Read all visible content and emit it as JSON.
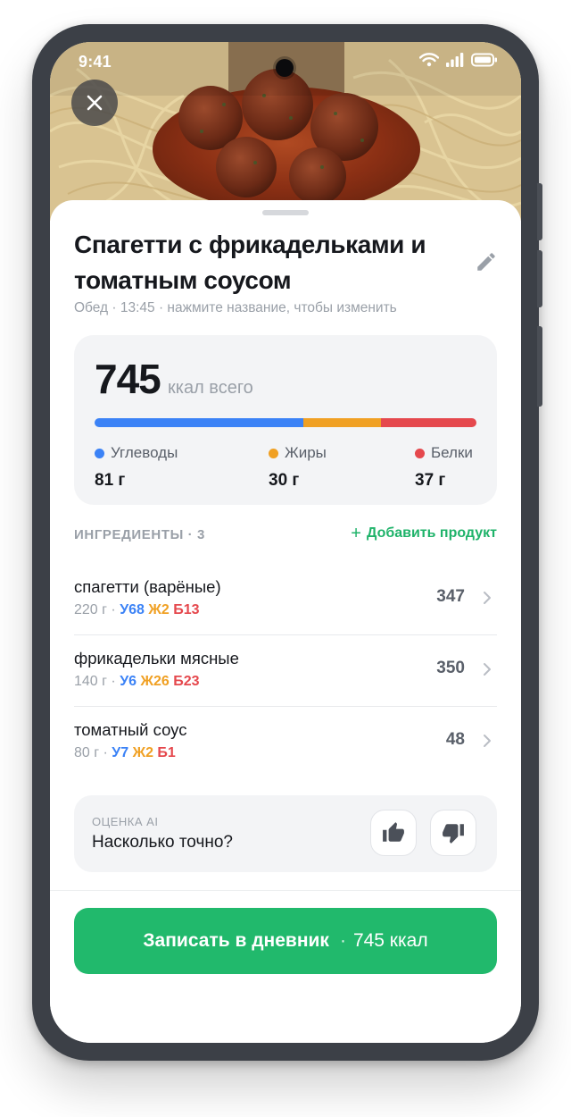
{
  "status_bar": {
    "time": "9:41"
  },
  "meal": {
    "title": "Спагетти с фрикадельками и томатным соусом",
    "subtitle": "Обед · 13:45 · нажмите название, чтобы изменить"
  },
  "summary": {
    "kcal_total": "745",
    "kcal_label": "ккал всего",
    "macros": [
      {
        "label": "Углеводы",
        "value": "81 г",
        "grams": 81,
        "color": "#3b82f6"
      },
      {
        "label": "Жиры",
        "value": "30 г",
        "grams": 30,
        "color": "#f0a023"
      },
      {
        "label": "Белки",
        "value": "37 г",
        "grams": 37,
        "color": "#e5484d"
      }
    ]
  },
  "ingredients": {
    "header": "ИНГРЕДИЕНТЫ · 3",
    "add_label": "Добавить продукт",
    "items": [
      {
        "name": "спагетти (варёные)",
        "weight": "220 г",
        "carbs": "У68",
        "fat": "Ж2",
        "protein": "Б13",
        "kcal": "347"
      },
      {
        "name": "фрикадельки мясные",
        "weight": "140 г",
        "carbs": "У6",
        "fat": "Ж26",
        "protein": "Б23",
        "kcal": "350"
      },
      {
        "name": "томатный соус",
        "weight": "80 г",
        "carbs": "У7",
        "fat": "Ж2",
        "protein": "Б1",
        "kcal": "48"
      }
    ]
  },
  "ai_rating": {
    "kicker": "ОЦЕНКА AI",
    "question": "Насколько точно?"
  },
  "cta": {
    "label": "Записать в дневник",
    "separator": "·",
    "kcal": "745 ккал"
  },
  "colors": {
    "accent_green": "#21b96c",
    "carbs": "#3b82f6",
    "fat": "#f0a023",
    "protein": "#e5484d"
  },
  "icons": {
    "close": "close-icon",
    "edit": "pencil-icon",
    "add": "plus-icon",
    "chevron": "chevron-right-icon",
    "thumbs_up": "thumbs-up-icon",
    "thumbs_down": "thumbs-down-icon"
  }
}
